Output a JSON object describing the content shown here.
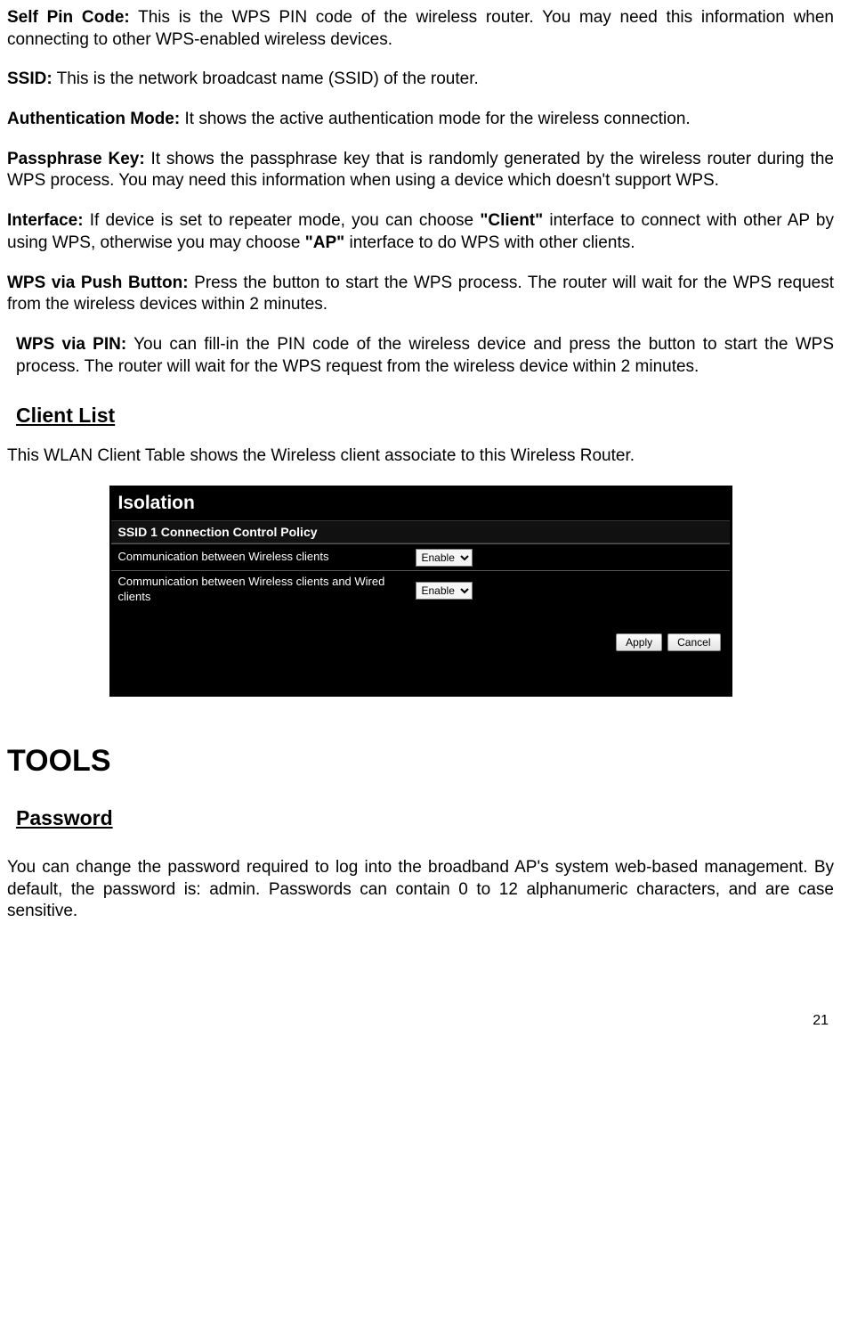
{
  "items": [
    {
      "label": "Self Pin Code:",
      "text": " This is the WPS PIN code of the wireless router. You may need this information when connecting to other WPS-enabled wireless devices."
    },
    {
      "label": "SSID:",
      "text": " This is the network broadcast name (SSID) of the router."
    },
    {
      "label": "Authentication Mode:",
      "text": " It shows the active authentication mode for the wireless connection."
    },
    {
      "label": "Passphrase Key:",
      "text": " It shows the passphrase key that is randomly generated by the wireless router during the WPS process. You may need this information when using a device which doesn't support WPS."
    }
  ],
  "interface": {
    "label": "Interface:",
    "t1": " If device is set to repeater mode, you can choose ",
    "b1": "\"Client\"",
    "t2": " interface to connect with other AP by using WPS, otherwise you may choose ",
    "b2": "\"AP\"",
    "t3": " interface to do WPS with other clients."
  },
  "pushbtn": {
    "label": "WPS via Push Button:",
    "text": " Press the button to start the WPS process. The router will wait for the WPS request from the wireless devices within 2 minutes."
  },
  "pin": {
    "label": "WPS via PIN:",
    "text": " You can fill-in the PIN code of the wireless device and press the button to start the WPS process. The router will wait for the WPS request from the wireless device within 2 minutes."
  },
  "clientlist": {
    "heading": "Client List",
    "text": "This WLAN Client Table shows the Wireless client associate to this Wireless Router."
  },
  "screenshot": {
    "title": "Isolation",
    "subtitle": "SSID 1 Connection Control Policy",
    "row1_label": "Communication between Wireless clients",
    "row1_value": "Enable",
    "row2_label": "Communication between Wireless clients and Wired clients",
    "row2_value": "Enable",
    "apply": "Apply",
    "cancel": "Cancel"
  },
  "tools": {
    "heading": "TOOLS",
    "password_heading": "Password",
    "password_text": "You can change the password required to log into the broadband AP's system web-based management. By default, the password is: admin. Passwords can contain 0 to 12 alphanumeric characters, and are case sensitive."
  },
  "page_number": "21"
}
